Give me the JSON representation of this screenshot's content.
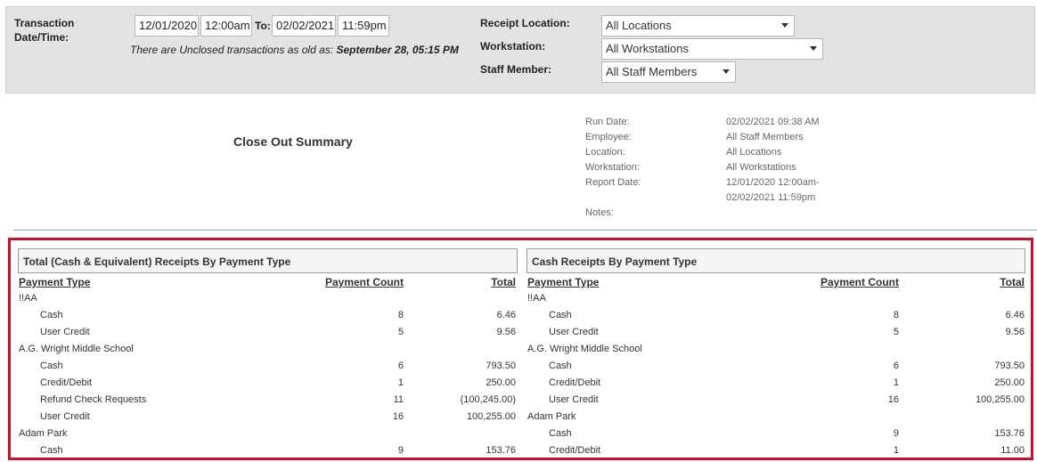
{
  "filters": {
    "date_label": "Transaction\nDate/Time:",
    "from_date": "12/01/2020",
    "from_time": "12:00am",
    "to_label": "To:",
    "to_date": "02/02/2021",
    "to_time": "11:59pm",
    "notice_prefix": "There are Unclosed transactions as old as:",
    "notice_date": "September 28, 05:15 PM",
    "receipt_location_label": "Receipt Location:",
    "receipt_location_value": "All Locations",
    "workstation_label": "Workstation:",
    "workstation_value": "All Workstations",
    "staff_label": "Staff Member:",
    "staff_value": "All Staff Members"
  },
  "report": {
    "title": "Close Out Summary",
    "meta": [
      {
        "key": "Run Date:",
        "value": "02/02/2021 09:38 AM"
      },
      {
        "key": "Employee:",
        "value": "All Staff Members"
      },
      {
        "key": "Location:",
        "value": "All Locations"
      },
      {
        "key": "Workstation:",
        "value": "All Workstations"
      },
      {
        "key": "Report Date:",
        "value": "12/01/2020 12:00am-\n02/02/2021 11:59pm"
      },
      {
        "key": "Notes:",
        "value": ""
      }
    ]
  },
  "tables": [
    {
      "title": "Total (Cash & Equivalent) Receipts By Payment Type",
      "headers": {
        "type": "Payment Type",
        "count": "Payment Count",
        "total": "Total"
      },
      "rows": [
        {
          "group": "!!AA"
        },
        {
          "type": "Cash",
          "count": "8",
          "total": "6.46"
        },
        {
          "type": "User Credit",
          "count": "5",
          "total": "9.56"
        },
        {
          "group": "A.G. Wright Middle School"
        },
        {
          "type": "Cash",
          "count": "6",
          "total": "793.50"
        },
        {
          "type": "Credit/Debit",
          "count": "1",
          "total": "250.00"
        },
        {
          "type": "Refund Check Requests",
          "count": "11",
          "total": "(100,245.00)"
        },
        {
          "type": "User Credit",
          "count": "16",
          "total": "100,255.00"
        },
        {
          "group": "Adam Park"
        },
        {
          "type": "Cash",
          "count": "9",
          "total": "153.76"
        }
      ]
    },
    {
      "title": "Cash Receipts By Payment Type",
      "headers": {
        "type": "Payment Type",
        "count": "Payment Count",
        "total": "Total"
      },
      "rows": [
        {
          "group": "!!AA"
        },
        {
          "type": "Cash",
          "count": "8",
          "total": "6.46"
        },
        {
          "type": "User Credit",
          "count": "5",
          "total": "9.56"
        },
        {
          "group": "A.G. Wright Middle School"
        },
        {
          "type": "Cash",
          "count": "6",
          "total": "793.50"
        },
        {
          "type": "Credit/Debit",
          "count": "1",
          "total": "250.00"
        },
        {
          "type": "User Credit",
          "count": "16",
          "total": "100,255.00"
        },
        {
          "group": "Adam Park"
        },
        {
          "type": "Cash",
          "count": "9",
          "total": "153.76"
        },
        {
          "type": "Credit/Debit",
          "count": "1",
          "total": "11.00"
        }
      ]
    }
  ],
  "colors": {
    "highlight_border": "#c3122a",
    "panel_bg": "#e3e3e3"
  }
}
